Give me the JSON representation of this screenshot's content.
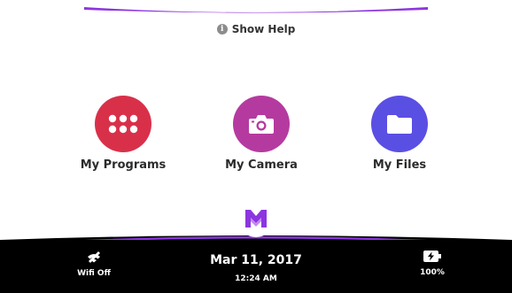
{
  "header": {
    "help_label": "Show Help",
    "help_icon": "info-circle-icon"
  },
  "apps": [
    {
      "label": "My Programs",
      "icon": "grid-dots-icon",
      "color": "#d9304a"
    },
    {
      "label": "My Camera",
      "icon": "camera-icon",
      "color": "#b53aa0"
    },
    {
      "label": "My Files",
      "icon": "folder-icon",
      "color": "#5a4fe3"
    }
  ],
  "logo": {
    "icon": "mw-logo-icon",
    "color": "#8c35e0"
  },
  "status_bar": {
    "wifi": {
      "label": "Wifi Off",
      "icon": "wifi-off-icon"
    },
    "date": "Mar 11, 2017",
    "time": "12:24 AM",
    "battery": {
      "label": "100%",
      "icon": "battery-charging-icon"
    }
  },
  "colors": {
    "accent": "#8c35e0",
    "status_bar_bg": "#000000"
  }
}
